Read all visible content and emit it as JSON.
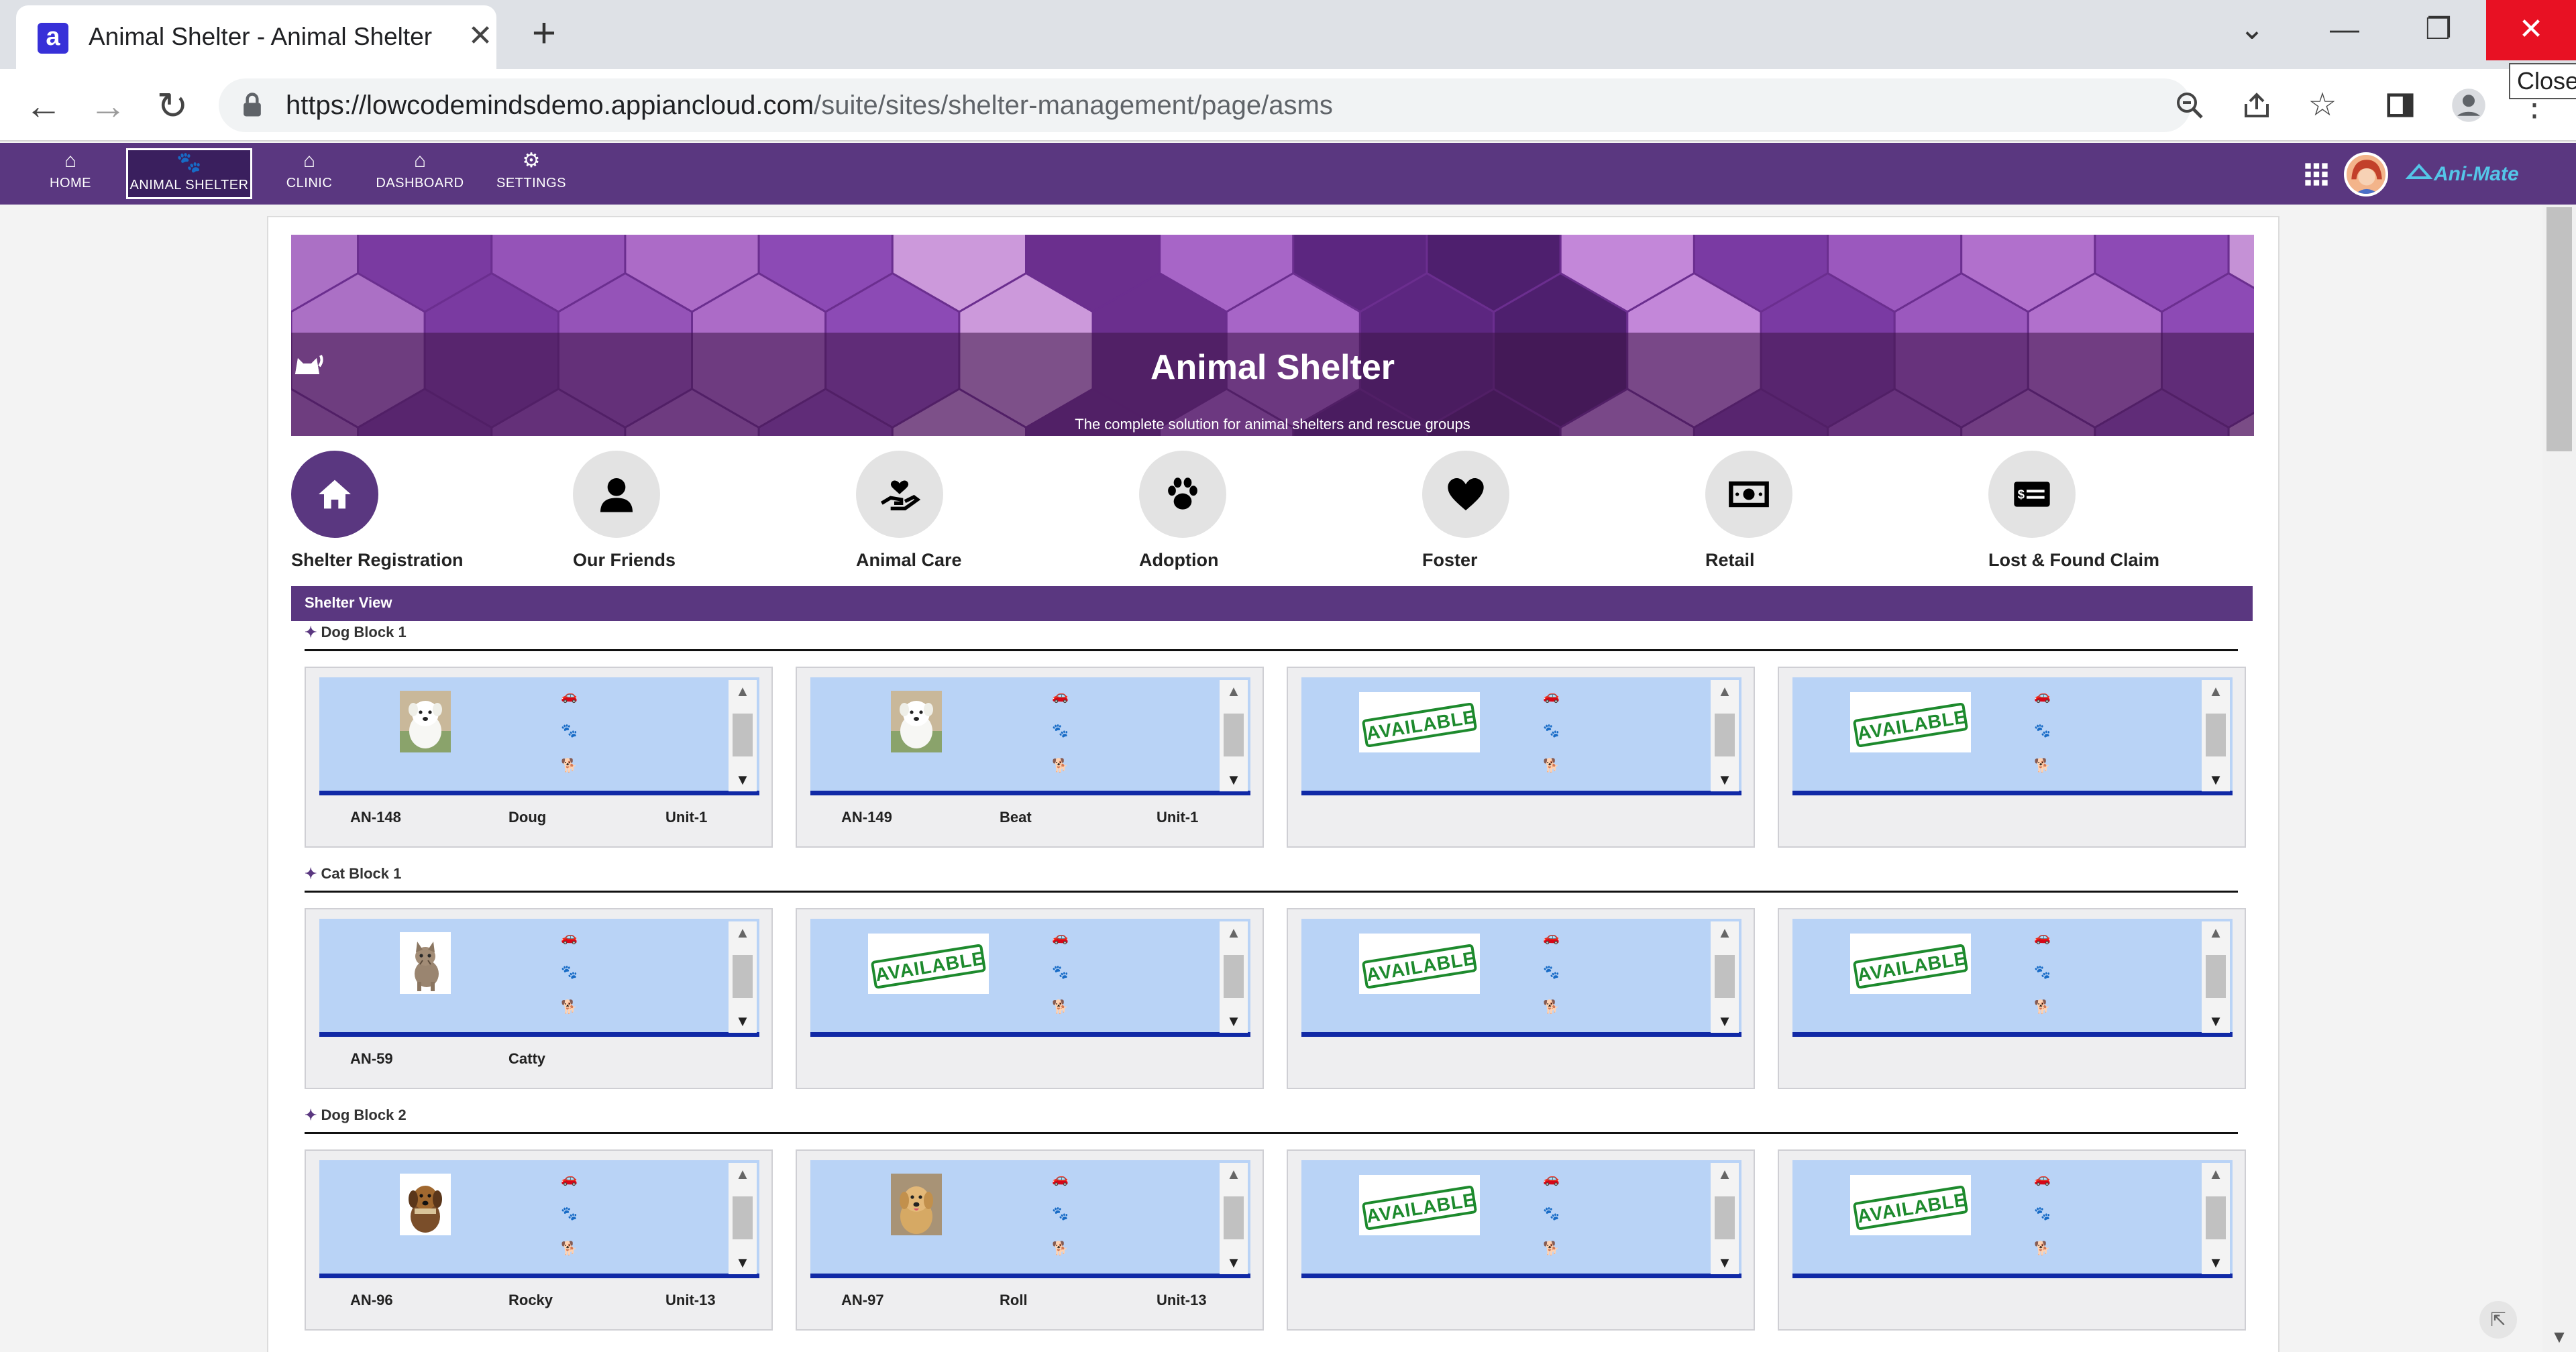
{
  "browser": {
    "tab_title": "Animal Shelter - Animal Shelter M",
    "tab_favicon": "a",
    "url_host": "https://lowcodemindsdemo.appiancloud.com",
    "url_path": "/suite/sites/shelter-management/page/asms",
    "close_tooltip": "Close"
  },
  "nav": {
    "items": [
      {
        "label": "HOME",
        "icon": "home-icon"
      },
      {
        "label": "ANIMAL SHELTER",
        "icon": "paw-icon"
      },
      {
        "label": "CLINIC",
        "icon": "home-icon"
      },
      {
        "label": "DASHBOARD",
        "icon": "home-icon"
      },
      {
        "label": "SETTINGS",
        "icon": "gear-icon"
      }
    ],
    "active": "ANIMAL SHELTER"
  },
  "hero": {
    "title": "Animal Shelter",
    "subtitle": "The complete solution for animal shelters and rescue groups"
  },
  "features": [
    {
      "label": "Shelter Registration",
      "icon": "house-icon",
      "active": true
    },
    {
      "label": "Our Friends",
      "icon": "person-icon"
    },
    {
      "label": "Animal Care",
      "icon": "hand-heart-icon"
    },
    {
      "label": "Adoption",
      "icon": "paw-icon"
    },
    {
      "label": "Foster",
      "icon": "heart-icon"
    },
    {
      "label": "Retail",
      "icon": "money-icon"
    },
    {
      "label": "Lost & Found Claim",
      "icon": "card-icon"
    }
  ],
  "shelter_view": {
    "header": "Shelter View",
    "available_label": "AVAILABLE",
    "blocks": [
      {
        "name": "Dog Block 1",
        "units": [
          {
            "status": "occupied",
            "animal": "dog-white",
            "id": "AN-148",
            "name": "Doug",
            "unit": "Unit-1"
          },
          {
            "status": "occupied",
            "animal": "dog-white",
            "id": "AN-149",
            "name": "Beat",
            "unit": "Unit-1"
          },
          {
            "status": "available"
          },
          {
            "status": "available"
          }
        ]
      },
      {
        "name": "Cat Block 1",
        "units": [
          {
            "status": "occupied",
            "animal": "cat",
            "id": "AN-59",
            "name": "Catty",
            "unit": ""
          },
          {
            "status": "available"
          },
          {
            "status": "available"
          },
          {
            "status": "available"
          }
        ]
      },
      {
        "name": "Dog Block 2",
        "units": [
          {
            "status": "occupied",
            "animal": "dog-brown",
            "id": "AN-96",
            "name": "Rocky",
            "unit": "Unit-13"
          },
          {
            "status": "occupied",
            "animal": "dog-golden",
            "id": "AN-97",
            "name": "Roll",
            "unit": "Unit-13"
          },
          {
            "status": "available"
          },
          {
            "status": "available"
          }
        ]
      }
    ]
  },
  "colors": {
    "nav_bg": "#5a3780",
    "header_bg": "#5a3780",
    "unit_bg": "#b9d3f6",
    "unit_bar": "#1029a6",
    "available_green": "#1d8a2d",
    "close_red": "#e81123"
  }
}
